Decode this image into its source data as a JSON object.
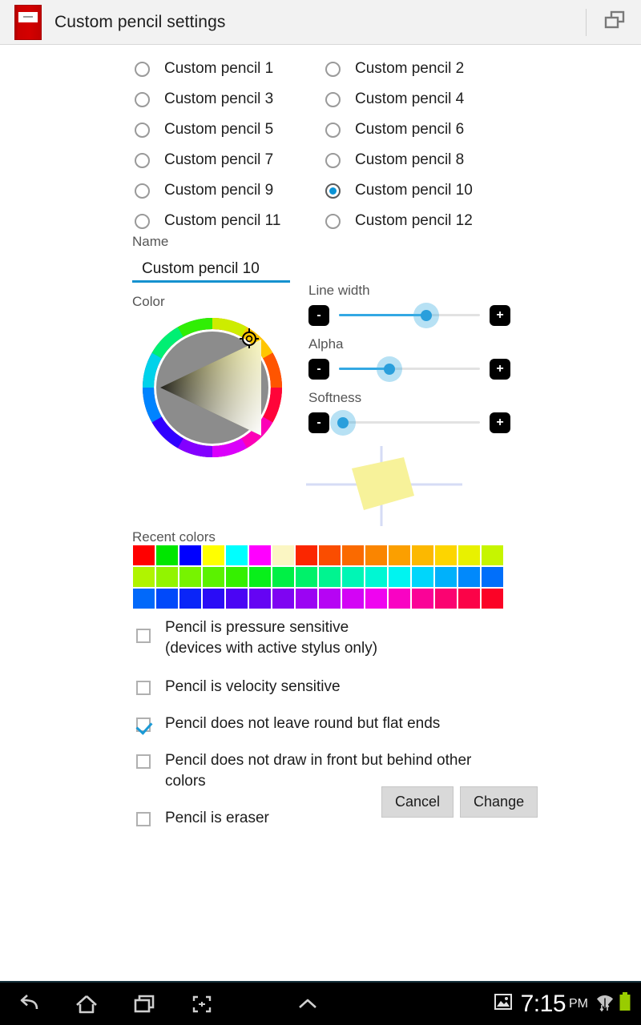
{
  "titlebar": {
    "app_icon_name": "red-notebook-icon",
    "title": "Custom pencil settings",
    "multiwindow_icon": "multi-window-icon"
  },
  "pencils": {
    "items": [
      {
        "label": "Custom pencil 1",
        "selected": false
      },
      {
        "label": "Custom pencil 2",
        "selected": false
      },
      {
        "label": "Custom pencil 3",
        "selected": false
      },
      {
        "label": "Custom pencil 4",
        "selected": false
      },
      {
        "label": "Custom pencil 5",
        "selected": false
      },
      {
        "label": "Custom pencil 6",
        "selected": false
      },
      {
        "label": "Custom pencil 7",
        "selected": false
      },
      {
        "label": "Custom pencil 8",
        "selected": false
      },
      {
        "label": "Custom pencil 9",
        "selected": false
      },
      {
        "label": "Custom pencil 10",
        "selected": true
      },
      {
        "label": "Custom pencil 11",
        "selected": false
      },
      {
        "label": "Custom pencil 12",
        "selected": false
      }
    ]
  },
  "name_field": {
    "label": "Name",
    "value": "Custom pencil 10",
    "placeholder": "Name",
    "underline_color": "#1591cf"
  },
  "color_section": {
    "label": "Color",
    "wheel_marker_hue_deg": 56,
    "selected_color": "#f7f29a"
  },
  "sliders": [
    {
      "title": "Line width",
      "minus": "-",
      "plus": "+",
      "value_pct": 62
    },
    {
      "title": "Alpha",
      "minus": "-",
      "plus": "+",
      "value_pct": 36
    },
    {
      "title": "Softness",
      "minus": "-",
      "plus": "+",
      "value_pct": 3
    }
  ],
  "preview": {
    "name": "stroke-preview",
    "stroke_color": "#f7f29a",
    "guide_color": "#d6dcf5"
  },
  "recent_colors": {
    "label": "Recent colors",
    "rows": [
      [
        "#ff0000",
        "#00e600",
        "#0000ff",
        "#ffff00",
        "#00ffff",
        "#ff00ff",
        "#fbf6c3",
        "#fb2600",
        "#fa4d00",
        "#fa6a00",
        "#fa8500",
        "#fb9f00",
        "#fcb800",
        "#fdd500",
        "#e8f100",
        "#c6f500"
      ],
      [
        "#b0f400",
        "#92f400",
        "#77f300",
        "#5bf200",
        "#35f000",
        "#08ef1a",
        "#00f045",
        "#00f16a",
        "#00f490",
        "#00f6b5",
        "#00f7d3",
        "#00f4f0",
        "#00d6fb",
        "#00b1fb",
        "#0189fb",
        "#016ffa"
      ],
      [
        "#0169fa",
        "#0049fa",
        "#0a25f8",
        "#2a0cf6",
        "#4b05f4",
        "#6504f3",
        "#7f04f2",
        "#9b04f3",
        "#b604f4",
        "#d304f5",
        "#ef04f0",
        "#f903c3",
        "#fa0397",
        "#fb0371",
        "#fb0348",
        "#fb0326"
      ]
    ]
  },
  "checkboxes": [
    {
      "label": "Pencil is pressure sensitive\n(devices with active stylus only)",
      "checked": false,
      "two_line": true
    },
    {
      "label": "Pencil is velocity sensitive",
      "checked": false,
      "two_line": false
    },
    {
      "label": "Pencil does not leave round but flat ends",
      "checked": true,
      "two_line": false
    },
    {
      "label": "Pencil does not draw in front but behind other colors",
      "checked": false,
      "two_line": false
    },
    {
      "label": "Pencil is eraser",
      "checked": false,
      "two_line": false
    }
  ],
  "buttons": {
    "cancel": "Cancel",
    "change": "Change"
  },
  "navbar": {
    "back_icon": "back-arrow-icon",
    "home_icon": "home-icon",
    "recents_icon": "recent-apps-icon",
    "screenshot_icon": "screenshot-capture-icon",
    "expand_icon": "chevron-up-icon",
    "picture_icon": "picture-icon",
    "time": "7:15",
    "ampm": "PM",
    "wifi_icon": "wifi-icon",
    "battery_icon": "battery-full-icon",
    "battery_color": "#99cc00"
  }
}
